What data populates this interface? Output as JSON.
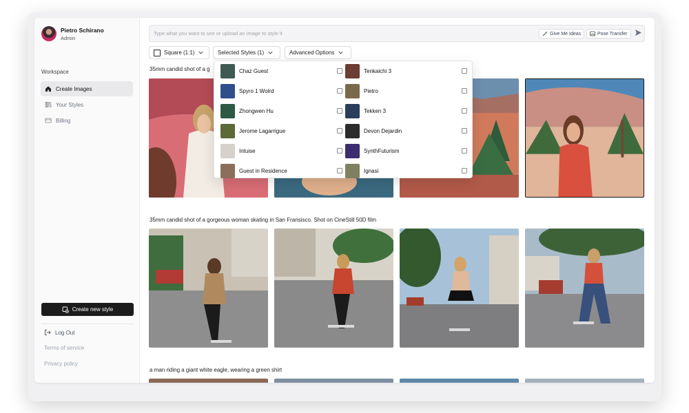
{
  "user": {
    "name": "Pietro Schirano",
    "role": "Admin"
  },
  "sidebar": {
    "section_label": "Workspace",
    "items": [
      {
        "label": "Create Images",
        "icon": "home-icon",
        "active": true
      },
      {
        "label": "Your Styles",
        "icon": "library-icon",
        "active": false
      },
      {
        "label": "Billing",
        "icon": "credit-card-icon",
        "active": false
      }
    ],
    "create_button": "Create new style",
    "logout": "Log Out",
    "terms": "Terms of service",
    "privacy": "Privacy policy"
  },
  "prompt_bar": {
    "placeholder": "Type what you want to see or upload an image to style it",
    "give_me_ideas": "Give Me Ideas",
    "pose_transfer": "Pose Transfer"
  },
  "controls": {
    "aspect": "Square (1:1)",
    "styles": "Selected Styles (1)",
    "advanced": "Advanced Options"
  },
  "styles_dropdown": [
    {
      "name": "Chaz Guest",
      "checked": false,
      "thumb_color": "#3e5a52"
    },
    {
      "name": "Tenkaichi 3",
      "checked": false,
      "thumb_color": "#6b3d33"
    },
    {
      "name": "Spyro 1 Wolrd",
      "checked": false,
      "thumb_color": "#2e4e8c"
    },
    {
      "name": "Pietro",
      "checked": false,
      "thumb_color": "#7a6a4c"
    },
    {
      "name": "Zhongwen Hu",
      "checked": false,
      "thumb_color": "#2e5a45"
    },
    {
      "name": "Tekken 3",
      "checked": false,
      "thumb_color": "#2a3d5c"
    },
    {
      "name": "Jerome Lagarrigue",
      "checked": false,
      "thumb_color": "#5b6a36"
    },
    {
      "name": "Devon Dejardin",
      "checked": false,
      "thumb_color": "#2b2b2b"
    },
    {
      "name": "Intuise",
      "checked": false,
      "thumb_color": "#d7d1cc"
    },
    {
      "name": "SynthFuturism",
      "checked": false,
      "thumb_color": "#3b2d6e"
    },
    {
      "name": "Guest in Residence",
      "checked": false,
      "thumb_color": "#8c6f5a"
    },
    {
      "name": "Ignasi",
      "checked": false,
      "thumb_color": "#7e8060"
    }
  ],
  "gallery": [
    {
      "prompt": "35mm candid shot of a g"
    },
    {
      "prompt": "35mm candid shot of a gorgeous woman skating in San Fransisco. Shot on CineStill 50D film"
    },
    {
      "prompt": "a man riding a giant white eagle, wearing a green shirt"
    }
  ]
}
